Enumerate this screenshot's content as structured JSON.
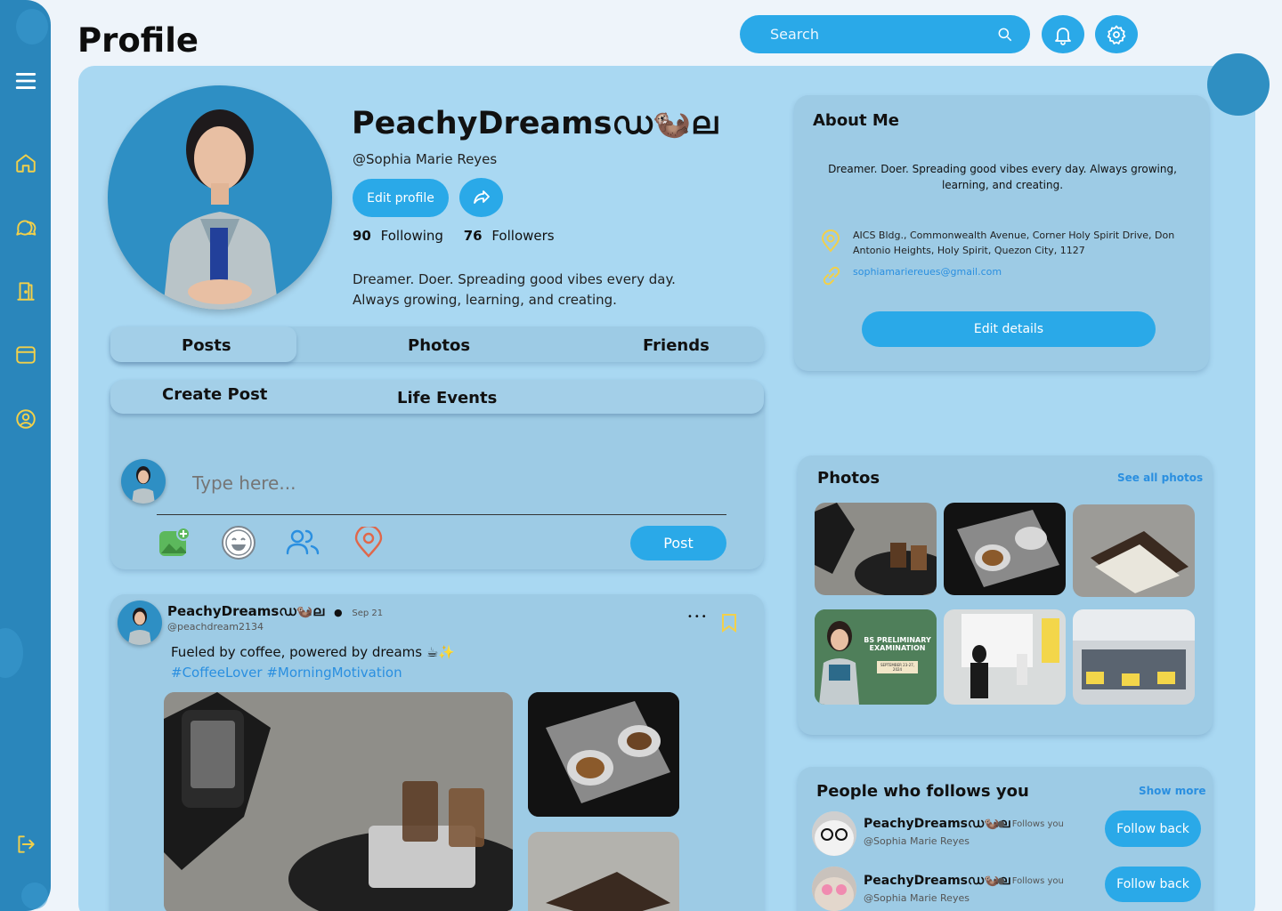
{
  "page": {
    "title": "Profile"
  },
  "search": {
    "placeholder": "Search"
  },
  "profile": {
    "display_name": "PeachyDreamsഡ🦦ല",
    "handle": "@Sophia Marie Reyes",
    "edit_profile": "Edit profile",
    "following_count": "90",
    "following_label": "Following",
    "followers_count": "76",
    "followers_label": "Followers",
    "bio_line1": "Dreamer. Doer. Spreading good vibes every day.",
    "bio_line2": "Always growing, learning, and creating."
  },
  "tabs": [
    "Posts",
    "Photos",
    "Friends"
  ],
  "subtabs": [
    "Create Post",
    "Life Events"
  ],
  "composer": {
    "placeholder": "Type here...",
    "post_label": "Post"
  },
  "post": {
    "author": "PeachyDreamsഡ🦦ല",
    "date": "Sep 21",
    "handle": "@peachdream2134",
    "text": "Fueled by coffee, powered by dreams ☕✨",
    "hashtags": "#CoffeeLover #MorningMotivation",
    "more": "•••"
  },
  "about": {
    "title": "About Me",
    "bio": "Dreamer. Doer. Spreading good vibes every day. Always growing, learning, and creating.",
    "address": "AICS Bldg., Commonwealth Avenue, Corner Holy Spirit Drive, Don Antonio Heights, Holy Spirit, Quezon City, 1127",
    "email": "sophiamariereues@gmail.com",
    "edit_details": "Edit details"
  },
  "photos": {
    "title": "Photos",
    "see_all": "See all photos",
    "exam_poster_title": "BS PRELIMINARY EXAMINATION",
    "exam_poster_date": "SEPTEMBER 23-27, 2024"
  },
  "followers_panel": {
    "title": "People who follows you",
    "show_more": "Show more",
    "items": [
      {
        "name": "PeachyDreamsഡ🦦ല",
        "status": "Follows you",
        "handle": "@Sophia Marie Reyes",
        "button": "Follow back"
      },
      {
        "name": "PeachyDreamsഡ🦦ല",
        "status": "Follows you",
        "handle": "@Sophia Marie Reyes",
        "button": "Follow back"
      }
    ]
  },
  "colors": {
    "accent": "#2aa9e8",
    "sidebar": "#2a86bb",
    "icon_yellow": "#f2d04a",
    "panel": "#a9d8f2"
  }
}
